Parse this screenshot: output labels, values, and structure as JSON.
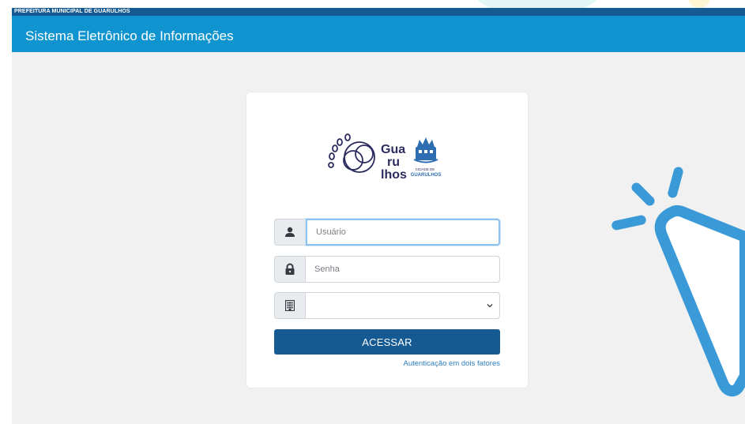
{
  "org_bar": {
    "text": "PREFEITURA MUNICIPAL DE GUARULHOS"
  },
  "header": {
    "title": "Sistema Eletrônico de Informações"
  },
  "logo": {
    "line1": "Gua",
    "line2": "ru",
    "line3": "lhos",
    "seal_line1": "CIDADE DE",
    "seal_line2": "GUARULHOS"
  },
  "login": {
    "user_placeholder": "Usuário",
    "password_placeholder": "Senha",
    "org_select_value": "",
    "submit_label": "ACESSAR",
    "two_factor_link": "Autenticação em dois fatores"
  },
  "icons": {
    "user": "user-icon",
    "lock": "lock-icon",
    "building": "building-icon",
    "chevron": "chevron-down-icon"
  },
  "colors": {
    "top_bar": "#155a92",
    "title_bar": "#0f94cf",
    "button": "#155a92",
    "link": "#2a7fc1",
    "decor_cursor": "#3a9ad8"
  }
}
